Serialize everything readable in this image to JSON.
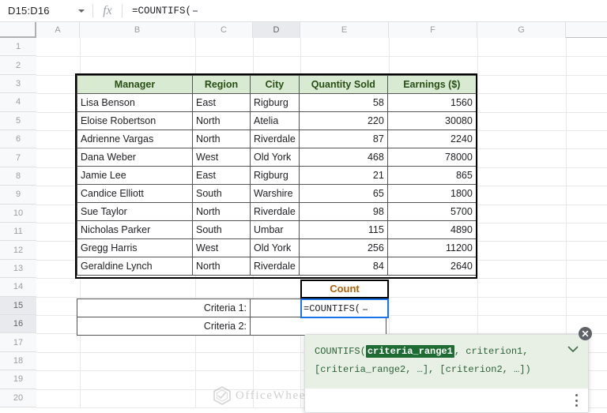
{
  "formula_bar": {
    "name_box_value": "D15:D16",
    "fx_label": "fx",
    "formula_value": "=COUNTIFS("
  },
  "grid": {
    "column_headers": [
      "A",
      "B",
      "C",
      "D",
      "E",
      "F",
      "G"
    ],
    "selected_column": "D",
    "row_numbers": [
      "1",
      "2",
      "3",
      "4",
      "5",
      "6",
      "7",
      "8",
      "9",
      "10",
      "11",
      "12",
      "13",
      "14",
      "15",
      "16",
      "17",
      "18",
      "19",
      "20"
    ],
    "selected_rows": [
      "15",
      "16"
    ]
  },
  "data_table": {
    "headers": [
      "Manager",
      "Region",
      "City",
      "Quantity Sold",
      "Earnings ($)"
    ],
    "rows": [
      [
        "Lisa Benson",
        "East",
        "Rigburg",
        "58",
        "1560"
      ],
      [
        "Eloise Robertson",
        "North",
        "Atelia",
        "220",
        "30080"
      ],
      [
        "Adrienne Vargas",
        "North",
        "Riverdale",
        "87",
        "2240"
      ],
      [
        "Dana Weber",
        "West",
        "Old York",
        "468",
        "78000"
      ],
      [
        "Jamie Lee",
        "East",
        "Rigburg",
        "21",
        "865"
      ],
      [
        "Candice Elliott",
        "South",
        "Warshire",
        "65",
        "1800"
      ],
      [
        "Sue Taylor",
        "North",
        "Riverdale",
        "98",
        "5700"
      ],
      [
        "Nicholas Parker",
        "South",
        "Umbar",
        "115",
        "4890"
      ],
      [
        "Gregg Harris",
        "West",
        "Old York",
        "256",
        "11200"
      ],
      [
        "Geraldine Lynch",
        "North",
        "Riverdale",
        "84",
        "2640"
      ]
    ]
  },
  "criteria_block": {
    "count_header": "Count",
    "criteria_1_label": "Criteria 1:",
    "criteria_1_value": "",
    "criteria_2_label": "Criteria 2:",
    "criteria_2_value": "",
    "active_cell_text": "=COUNTIFS("
  },
  "tooltip": {
    "line1_prefix": "COUNTIFS(",
    "line1_active_arg": "criteria_range1",
    "line1_suffix": ", criterion1,",
    "line2": "[criteria_range2, …], [criterion2, …])",
    "chevron_icon": "chevron-down-icon",
    "close_icon": "close-icon",
    "menu_icon": "more-vertical-icon"
  },
  "watermark": {
    "text": "OfficeWheel",
    "logo_icon": "officewheel-hex-logo"
  },
  "colors": {
    "header_fill": "#d9ead3",
    "header_text": "#274e13",
    "count_text": "#b45f06",
    "selection_border": "#1a73e8",
    "tooltip_bg": "#e8f0e6",
    "tooltip_text": "#2a6135",
    "tooltip_active_arg_bg": "#1e6b33"
  }
}
